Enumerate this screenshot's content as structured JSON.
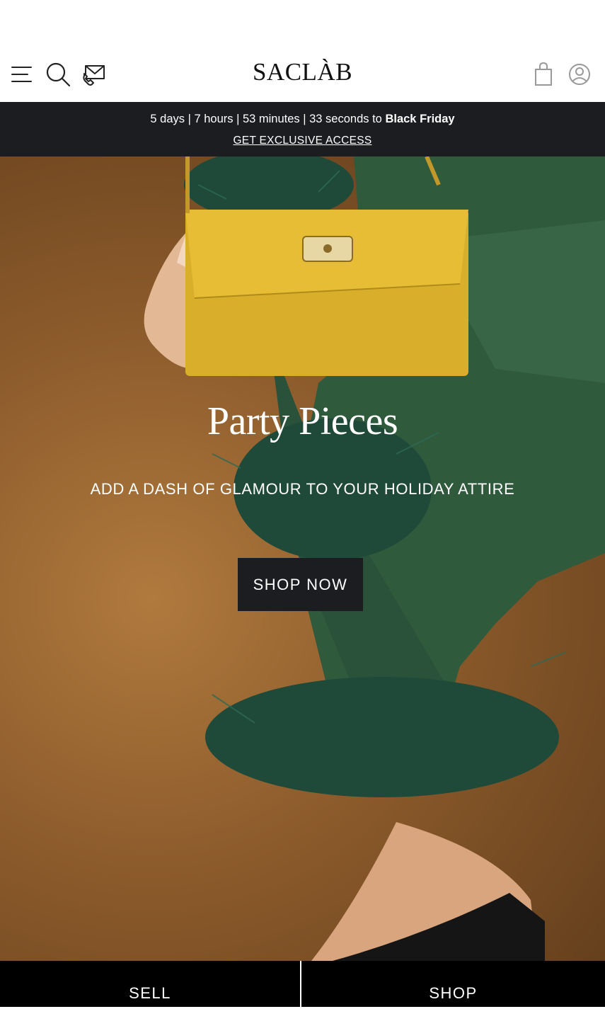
{
  "header": {
    "logo": "SACLÀB",
    "icons": [
      "menu-icon",
      "search-icon",
      "phone-mail-icon",
      "shopping-bag-icon",
      "account-icon"
    ]
  },
  "promo": {
    "countdown_prefix": "5 days | 7 hours | 53 minutes | 33 seconds to",
    "countdown_event": "Black Friday",
    "cta": "GET EXCLUSIVE ACCESS"
  },
  "hero": {
    "title": "Party Pieces",
    "subtitle": "ADD A DASH OF GLAMOUR TO YOUR HOLIDAY ATTIRE",
    "button": "SHOP NOW"
  },
  "bottom_nav": {
    "sell": "SELL",
    "shop": "SHOP"
  },
  "colors": {
    "dark_bar": "#1c1d21",
    "hero_background": "#8b5a2b",
    "bag": "#d9ae2a",
    "outfit": "#2f5a3c",
    "feather": "#1f4a3a"
  }
}
